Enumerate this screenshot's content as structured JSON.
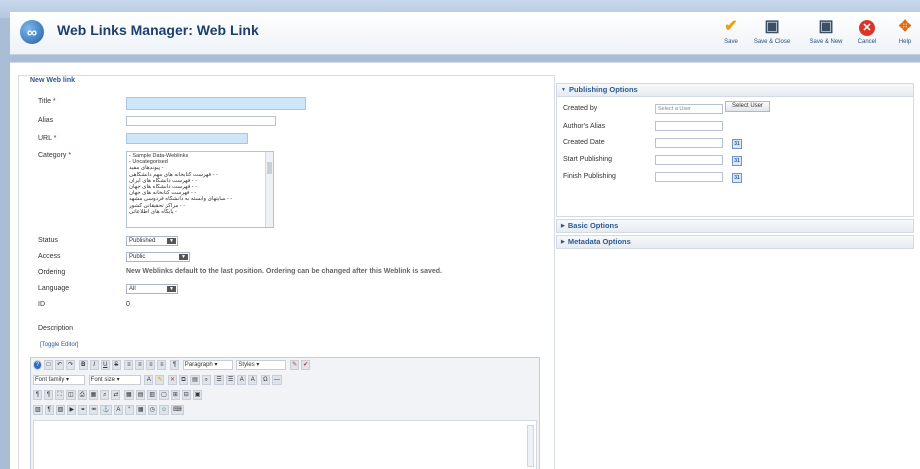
{
  "header": {
    "title": "Web Links Manager: Web Link",
    "toolbar": [
      {
        "label": "Save",
        "icon": "checkmark-icon"
      },
      {
        "label": "Save & Close",
        "icon": "save-close-icon"
      },
      {
        "label": "Save & New",
        "icon": "save-new-icon"
      },
      {
        "label": "Cancel",
        "icon": "cancel-icon"
      },
      {
        "label": "Help",
        "icon": "help-icon"
      }
    ]
  },
  "form": {
    "legend": "New Web link",
    "title_label": "Title",
    "alias_label": "Alias",
    "url_label": "URL",
    "category_label": "Category",
    "category_options": [
      "- Sample Data-Weblinks",
      "- Uncategorised",
      "پیوندهای مفید -",
      "فهرست کتابخانه های مهم دانشگاهی - -",
      "فهرست دانشگاه های ایران - -",
      "فهرست دانشگاه های جهان - -",
      "فهرست کتابخانه های جهان - -",
      "سایتهای وابسته به دانشگاه فردوسی مشهد - -",
      "مراکز تحقیقاتی کشور - -",
      "پایگاه های اطلاعاتی -"
    ],
    "status_label": "Status",
    "status_value": "Published",
    "access_label": "Access",
    "access_value": "Public",
    "ordering_label": "Ordering",
    "ordering_info": "New Weblinks default to the last position. Ordering can be changed after this Weblink is saved.",
    "language_label": "Language",
    "language_value": "All",
    "id_label": "ID",
    "id_value": "0",
    "description_label": "Description",
    "toggle_editor": "[Toggle Editor]"
  },
  "editor": {
    "paragraph_value": "Paragraph",
    "styles_value": "Styles",
    "font_family_value": "Font family",
    "font_size_value": "Font size"
  },
  "publishing": {
    "header": "Publishing Options",
    "created_by_label": "Created by",
    "created_by_placeholder": "Select a User",
    "select_user_button": "Select User",
    "author_alias_label": "Author's Alias",
    "created_date_label": "Created Date",
    "start_publishing_label": "Start Publishing",
    "finish_publishing_label": "Finish Publishing"
  },
  "basic_options": {
    "header": "Basic Options"
  },
  "metadata_options": {
    "header": "Metadata Options"
  },
  "colors": {
    "accent": "#2d5a91",
    "required": "#cc0000",
    "highlight_input": "#cfe6f8",
    "save_icon": "#f0a000",
    "cancel_icon": "#d9362b",
    "help_icon": "#e46a12"
  }
}
